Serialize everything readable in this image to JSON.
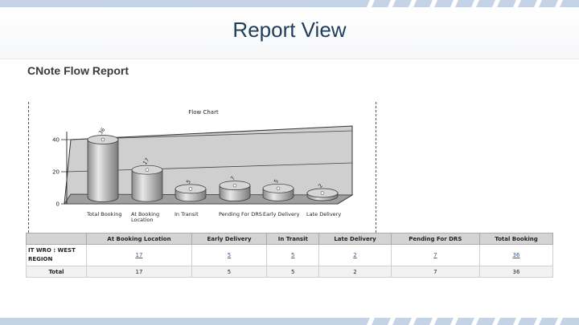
{
  "slide": {
    "title": "Report View"
  },
  "report": {
    "title": "CNote Flow Report"
  },
  "colors": {
    "stripe": "#c5d3e6",
    "title": "#1f3d5c",
    "bar": "#b5b5b5",
    "link": "#3355aa"
  },
  "chart_data": {
    "type": "bar",
    "title": "Flow Chart",
    "categories": [
      "Total Booking",
      "At Booking Location",
      "In Transit",
      "Pending For DRS",
      "Early Delivery",
      "Late Delivery"
    ],
    "values": [
      36,
      17,
      5,
      7,
      5,
      2
    ],
    "data_labels": [
      "36",
      "17",
      "5",
      "7",
      "5",
      "2"
    ],
    "yticks": [
      "0",
      "20",
      "40"
    ],
    "ylim": [
      0,
      45
    ],
    "style": "3d-cylinder",
    "grid": true
  },
  "table": {
    "headers": [
      "",
      "At Booking Location",
      "Early Delivery",
      "In Transit",
      "Late Delivery",
      "Pending For DRS",
      "Total Booking"
    ],
    "rows": [
      {
        "label": "IT WRO : WEST REGION",
        "cells": [
          "17",
          "5",
          "5",
          "2",
          "7",
          "36"
        ]
      }
    ],
    "total": {
      "label": "Total",
      "cells": [
        "17",
        "5",
        "5",
        "2",
        "7",
        "36"
      ]
    }
  }
}
